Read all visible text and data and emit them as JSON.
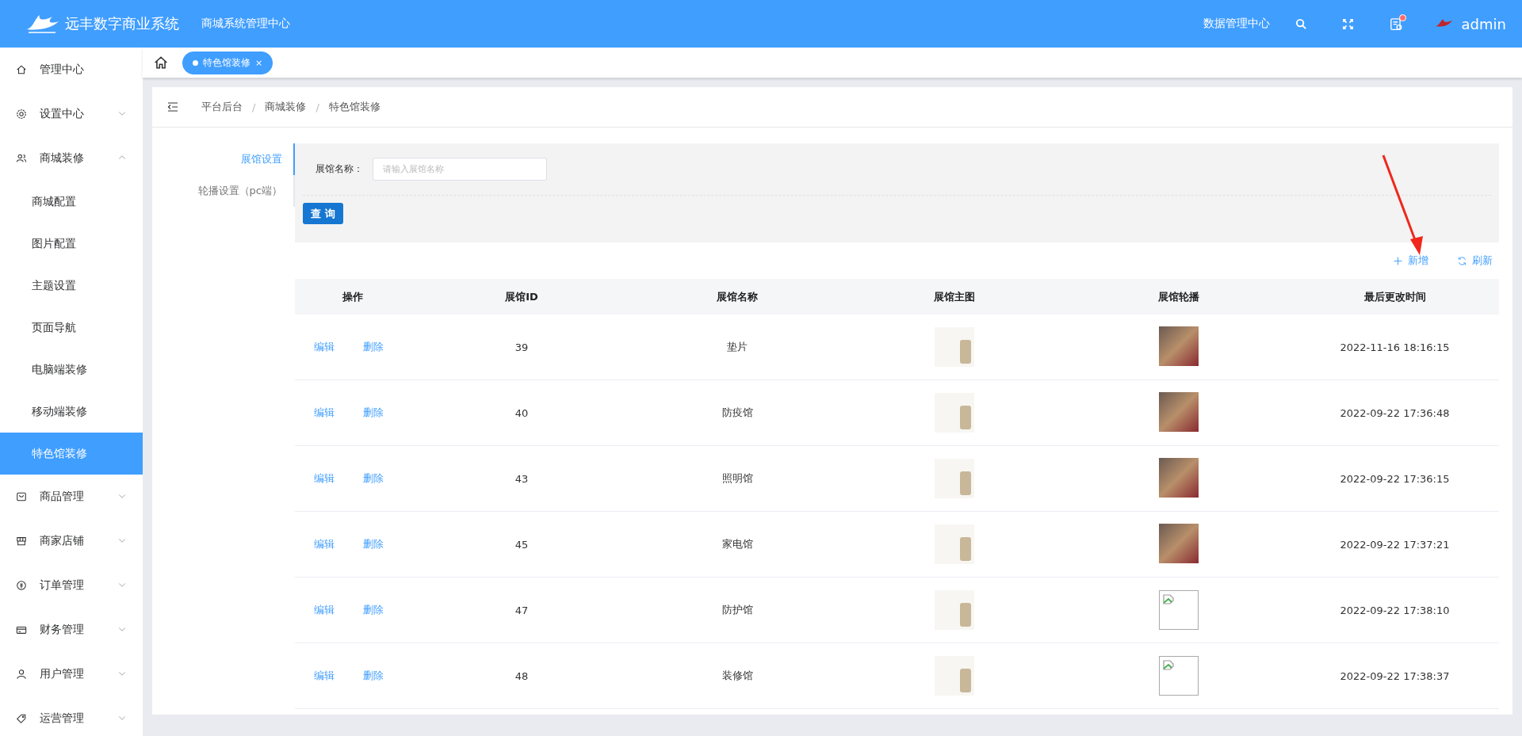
{
  "header": {
    "brand": "远丰数字商业系统",
    "subtitle": "商城系统管理中心",
    "data_center": "数据管理中心",
    "notification": true,
    "username": "admin"
  },
  "sidebar": {
    "items": [
      {
        "label": "管理中心",
        "kind": "link",
        "selected": false
      },
      {
        "label": "设置中心",
        "kind": "group",
        "expanded": false,
        "selected": false
      },
      {
        "label": "商城装修",
        "kind": "group",
        "expanded": true,
        "selected": false,
        "children": [
          {
            "label": "商城配置",
            "selected": false
          },
          {
            "label": "图片配置",
            "selected": false
          },
          {
            "label": "主题设置",
            "selected": false
          },
          {
            "label": "页面导航",
            "selected": false
          },
          {
            "label": "电脑端装修",
            "selected": false
          },
          {
            "label": "移动端装修",
            "selected": false
          },
          {
            "label": "特色馆装修",
            "selected": true
          }
        ]
      },
      {
        "label": "商品管理",
        "kind": "group",
        "expanded": false,
        "selected": false
      },
      {
        "label": "商家店铺",
        "kind": "group",
        "expanded": false,
        "selected": false
      },
      {
        "label": "订单管理",
        "kind": "group",
        "expanded": false,
        "selected": false
      },
      {
        "label": "财务管理",
        "kind": "group",
        "expanded": false,
        "selected": false
      },
      {
        "label": "用户管理",
        "kind": "group",
        "expanded": false,
        "selected": false
      },
      {
        "label": "运营管理",
        "kind": "group",
        "expanded": false,
        "selected": false
      }
    ]
  },
  "tabs": [
    {
      "label": "特色馆装修",
      "selected": true,
      "close": "×"
    }
  ],
  "breadcrumb": {
    "items": [
      "平台后台",
      "商城装修",
      "特色馆装修"
    ],
    "separator": "/"
  },
  "side_tabs": [
    {
      "label": "展馆设置",
      "selected": true
    },
    {
      "label": "轮播设置（pc端）",
      "selected": false
    }
  ],
  "search": {
    "label": "展馆名称：",
    "placeholder": "请输入展馆名称",
    "button": "查 询"
  },
  "toolbar": [
    "新增",
    "刷新"
  ],
  "table": {
    "columns": [
      "操作",
      "展馆ID",
      "展馆名称",
      "展馆主图",
      "展馆轮播",
      "最后更改时间"
    ],
    "rows": [
      {
        "actions": [
          "编辑",
          "删除"
        ],
        "id": "39",
        "name": "垫片",
        "carousel": {
          "kind": "photo"
        },
        "updated": "2022-11-16 18:16:15"
      },
      {
        "actions": [
          "编辑",
          "删除"
        ],
        "id": "40",
        "name": "防疫馆",
        "carousel": {
          "kind": "photo"
        },
        "updated": "2022-09-22 17:36:48"
      },
      {
        "actions": [
          "编辑",
          "删除"
        ],
        "id": "43",
        "name": "照明馆",
        "carousel": {
          "kind": "photo"
        },
        "updated": "2022-09-22 17:36:15"
      },
      {
        "actions": [
          "编辑",
          "删除"
        ],
        "id": "45",
        "name": "家电馆",
        "carousel": {
          "kind": "photo"
        },
        "updated": "2022-09-22 17:37:21"
      },
      {
        "actions": [
          "编辑",
          "删除"
        ],
        "id": "47",
        "name": "防护馆",
        "carousel": {
          "kind": "broken"
        },
        "updated": "2022-09-22 17:38:10"
      },
      {
        "actions": [
          "编辑",
          "删除"
        ],
        "id": "48",
        "name": "装修馆",
        "carousel": {
          "kind": "broken"
        },
        "updated": "2022-09-22 17:38:37"
      }
    ]
  }
}
